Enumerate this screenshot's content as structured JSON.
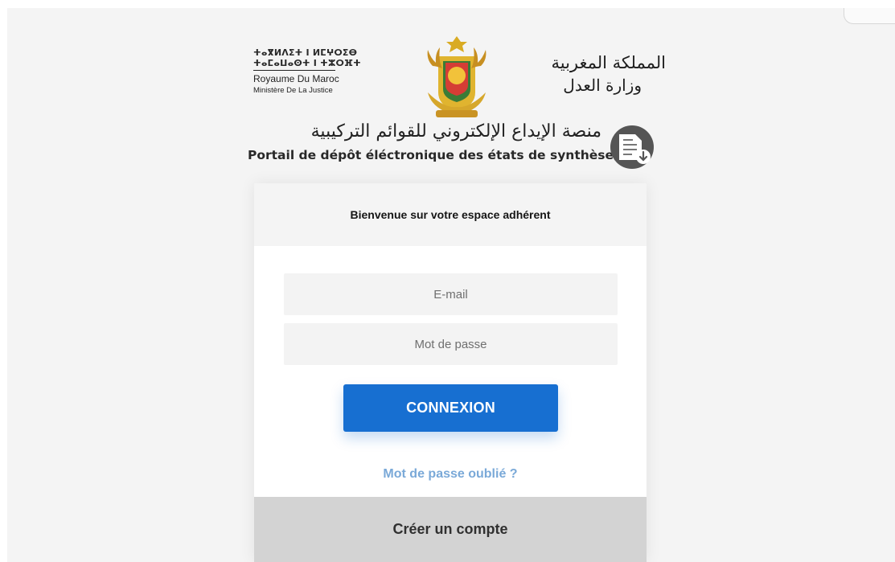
{
  "header": {
    "tifinagh_line_1": "ⵜⴰⴳⵍⴷⵉⵜ ⵏ ⵍⵎⵖⵔⵉⴱ",
    "tifinagh_line_2": "ⵜⴰⵎⴰⵡⴰⵙⵜ ⵏ ⵜⵣⵔⴼⵜ",
    "kingdom_fr": "Royaume Du Maroc",
    "ministry_fr": "Ministère De La Justice",
    "kingdom_ar": "المملكة المغربية",
    "ministry_ar": "وزارة العدل",
    "portal_ar": "منصة الإيداع الإلكتروني للقوائم التركيبية",
    "portal_fr": "Portail de dépôt éléctronique des états de synthèse"
  },
  "login": {
    "title": "Bienvenue sur votre espace adhérent",
    "email_placeholder": "E-mail",
    "password_placeholder": "Mot de passe",
    "submit_label": "CONNEXION",
    "forgot_password": "Mot de passe oublié ?",
    "create_account": "Créer un compte"
  },
  "colors": {
    "primary_button": "#176fd1",
    "link": "#7aa9d8",
    "footer_button": "#d3d3d3"
  },
  "icons": {
    "emblem": "moroccan-coat-of-arms",
    "portal": "document-download-icon"
  }
}
